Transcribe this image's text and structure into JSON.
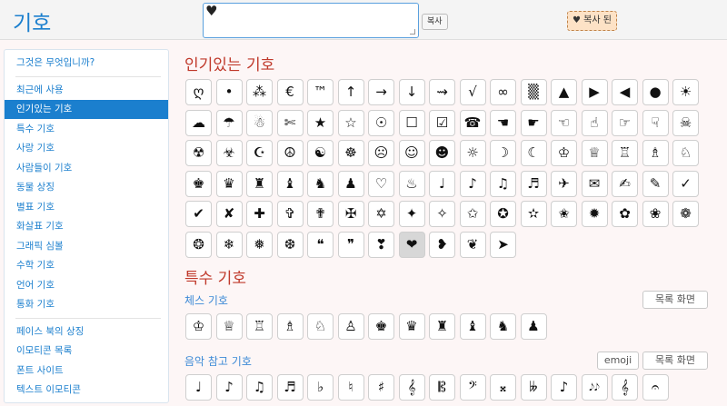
{
  "header": {
    "logo": "기호",
    "clipboard_value": "♥",
    "copy_label": "복사",
    "copied_label": "♥ 복사 된"
  },
  "sidebar": {
    "group1": [
      "그것은 무엇입니까?"
    ],
    "group2": [
      {
        "label": "최근에 사용",
        "active": false
      },
      {
        "label": "인기있는 기호",
        "active": true
      },
      {
        "label": "특수 기호",
        "active": false
      },
      {
        "label": "사랑 기호",
        "active": false
      },
      {
        "label": "사람들이 기호",
        "active": false
      },
      {
        "label": "동물 상징",
        "active": false
      },
      {
        "label": "별표 기호",
        "active": false
      },
      {
        "label": "화살표 기호",
        "active": false
      },
      {
        "label": "그래픽 심볼",
        "active": false
      },
      {
        "label": "수학 기호",
        "active": false
      },
      {
        "label": "언어 기호",
        "active": false
      },
      {
        "label": "통화 기호",
        "active": false
      }
    ],
    "group3": [
      "페이스 북의 상징",
      "이모티콘 목록",
      "폰트 사이트",
      "텍스트 이모티콘"
    ]
  },
  "popular": {
    "title": "인기있는 기호",
    "rows": [
      [
        "ღ",
        "•",
        "⁂",
        "€",
        "™",
        "↑",
        "→",
        "↓",
        "⇝",
        "√",
        "∞",
        "▒",
        "▲",
        "▶",
        "◀",
        "●",
        "☀"
      ],
      [
        "☁",
        "☂",
        "☃",
        "✄",
        "★",
        "☆",
        "☉",
        "☐",
        "☑",
        "☎",
        "☚",
        "☛",
        "☜",
        "☝",
        "☞",
        "☟",
        "☠"
      ],
      [
        "☢",
        "☣",
        "☪",
        "☮",
        "☯",
        "☸",
        "☹",
        "☺",
        "☻",
        "☼",
        "☽",
        "☾",
        "♔",
        "♕",
        "♖",
        "♗",
        "♘"
      ],
      [
        "♚",
        "♛",
        "♜",
        "♝",
        "♞",
        "♟",
        "♡",
        "♨",
        "♩",
        "♪",
        "♫",
        "♬",
        "✈",
        "✉",
        "✍",
        "✎",
        "✓"
      ],
      [
        "✔",
        "✘",
        "✚",
        "✞",
        "✟",
        "✠",
        "✡",
        "✦",
        "✧",
        "✩",
        "✪",
        "✫",
        "✬",
        "✹",
        "✿",
        "❀",
        "❁"
      ],
      [
        "❂",
        "❄",
        "❅",
        "❆",
        "❝",
        "❞",
        "❣",
        "❤",
        "❥",
        "❦",
        "➤"
      ]
    ],
    "selected": "❤"
  },
  "special": {
    "title": "특수 기호",
    "chess": {
      "title": "체스 기호",
      "list_btn": "목록 화면",
      "symbols": [
        "♔",
        "♕",
        "♖",
        "♗",
        "♘",
        "♙",
        "♚",
        "♛",
        "♜",
        "♝",
        "♞",
        "♟"
      ]
    },
    "music": {
      "title": "음악 참고 기호",
      "emoji_btn": "emoji",
      "list_btn": "목록 화면",
      "symbols": [
        "♩",
        "♪",
        "♫",
        "♬",
        "♭",
        "♮",
        "♯",
        "𝄞",
        "𝄡",
        "𝄢",
        "𝄪",
        "𝄫",
        "♪",
        "𝅘𝅥𝅮𝅘𝅥𝅮",
        "𝄞",
        "𝄐"
      ]
    }
  }
}
